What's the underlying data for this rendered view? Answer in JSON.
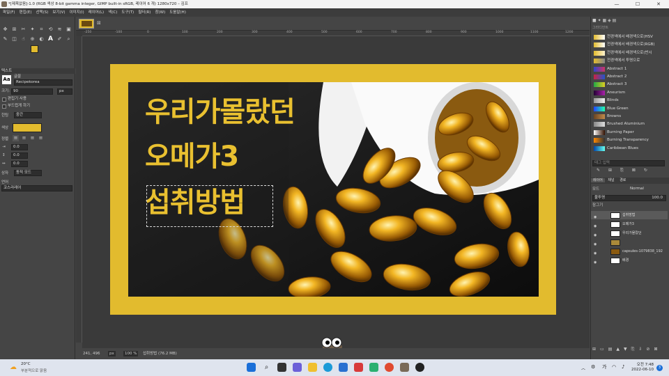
{
  "window": {
    "title": "*[제목없음]-1.0 (RGB 색상 8-bit gamma integer, GIMP built-in sRGB, 레이어 6 개) 1280x720 – 김프",
    "min": "—",
    "max": "☐",
    "close": "✕"
  },
  "menu": [
    "파일(F)",
    "편집(E)",
    "선택(S)",
    "보기(V)",
    "이미지(I)",
    "레이어(L)",
    "색(C)",
    "도구(T)",
    "필터(R)",
    "창(W)",
    "도움말(H)"
  ],
  "toolbox": {
    "fg_color": "#e2bb2e",
    "bg_color": "#ffffff"
  },
  "tool_options": {
    "section": "텍스트",
    "font_label": "글꼴",
    "font_value": "Recipekorea",
    "size_label": "크기:",
    "size_value": "90",
    "size_unit": "px",
    "editor_label": "편집기 사용",
    "antialias_label": "부드럽게 하기",
    "hinting_label": "힌팅",
    "hinting_value": "중간",
    "color_label": "색상",
    "color_value": "#e2bb2e",
    "justify_label": "정렬",
    "indent_value": "0.0",
    "line_spacing_value": "0.0",
    "letter_spacing_value": "0.0",
    "box_label": "상자",
    "box_value": "동적 모드",
    "language_label": "언어",
    "language_value": "코스라레어"
  },
  "canvas": {
    "line1": "우리가몰랐던",
    "line2": "오메가3",
    "line3": "섭취방법",
    "frame_color": "#e2bb2e"
  },
  "ruler_ticks": [
    "-250",
    "-100",
    "0",
    "100",
    "200",
    "300",
    "400",
    "500",
    "600",
    "700",
    "800",
    "900",
    "1000",
    "1100",
    "1200",
    "1300",
    "1400"
  ],
  "status": {
    "coords": "241, 496",
    "unit": "px",
    "zoom": "100 %",
    "message": "섭취방법 (76.2 MB)"
  },
  "gradients": {
    "title": "그라디언트",
    "items": [
      {
        "name": "전경색에서 배경색으로(HSV",
        "c1": "#e2bb2e",
        "c2": "#ffffff"
      },
      {
        "name": "전경색에서 배경색으로(RGB)",
        "c1": "#e2bb2e",
        "c2": "#ffffff"
      },
      {
        "name": "전경색에서 배경색으로(반시",
        "c1": "#e2bb2e",
        "c2": "#fff3d0"
      },
      {
        "name": "전경색에서 투명으로",
        "c1": "#e2bb2e",
        "c2": "#888888"
      },
      {
        "name": "Abstract 1",
        "c1": "#3344cc",
        "c2": "#cc3366"
      },
      {
        "name": "Abstract 2",
        "c1": "#cc2244",
        "c2": "#2255cc"
      },
      {
        "name": "Abstract 3",
        "c1": "#22aa44",
        "c2": "#ddcc22"
      },
      {
        "name": "Aneurism",
        "c1": "#220033",
        "c2": "#aa22aa"
      },
      {
        "name": "Blinds",
        "c1": "#999999",
        "c2": "#eeeeee"
      },
      {
        "name": "Blue Green",
        "c1": "#2244ff",
        "c2": "#22ffaa"
      },
      {
        "name": "Browns",
        "c1": "#6b4523",
        "c2": "#c08a4a"
      },
      {
        "name": "Brushed Aluminium",
        "c1": "#888888",
        "c2": "#dddddd"
      },
      {
        "name": "Burning Paper",
        "c1": "#ffffff",
        "c2": "#331100"
      },
      {
        "name": "Burning Transparency",
        "c1": "#ff8800",
        "c2": "#333333"
      },
      {
        "name": "Caribbean Blues",
        "c1": "#0044aa",
        "c2": "#66ffee"
      }
    ],
    "tag_placeholder": "태그 입력"
  },
  "layers": {
    "tabs": [
      "레이어",
      "채널",
      "경로"
    ],
    "mode_label": "모드",
    "mode_value": "Normal",
    "opacity_label": "불투명",
    "opacity_value": "100.0",
    "lock_label": "잠그기",
    "items": [
      {
        "name": "섭취방법",
        "type": "text"
      },
      {
        "name": "오메가3",
        "type": "text"
      },
      {
        "name": "우리가몰랐던",
        "type": "text"
      },
      {
        "name": "",
        "type": "transparent"
      },
      {
        "name": "capsules-1079838_192",
        "type": "photo"
      },
      {
        "name": "배경",
        "type": "white"
      }
    ]
  },
  "taskbar": {
    "weather_temp": "20°C",
    "weather_desc": "부분적으로 맑음",
    "time": "오전 7:48",
    "date": "2022-06-10",
    "ime": "가",
    "notif_count": "3"
  }
}
